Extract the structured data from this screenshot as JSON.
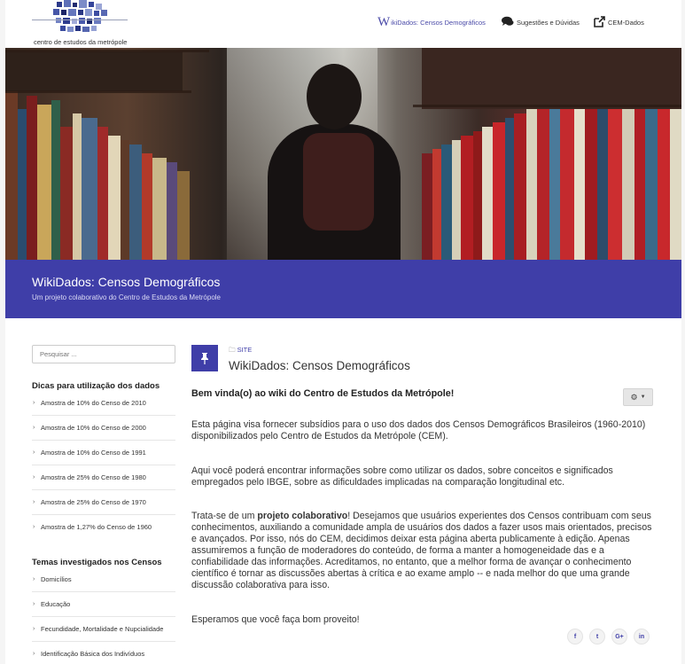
{
  "header": {
    "logo_text": "centro de estudos da metrópole",
    "nav": [
      {
        "prefix": "W",
        "label": "ikiDados: Censos Demográficos"
      },
      {
        "label": "Sugestões e Dúvidas",
        "icon": "comments-icon"
      },
      {
        "label": "CEM-Dados",
        "icon": "external-link-icon"
      }
    ]
  },
  "banner": {
    "title": "WikiDados: Censos Demográficos",
    "subtitle": "Um projeto colaborativo do Centro de Estudos da Metrópole"
  },
  "sidebar": {
    "search_placeholder": "Pesquisar ...",
    "section1_title": "Dicas para utilização dos dados",
    "section1_items": [
      "Amostra de 10% do Censo de 2010",
      "Amostra de 10% do Censo de 2000",
      "Amostra de 10% do Censo de 1991",
      "Amostra de 25% do Censo de 1980",
      "Amostra de 25% do Censo de 1970",
      "Amostra de 1,27% do Censo de 1960"
    ],
    "section2_title": "Temas investigados nos Censos",
    "section2_items": [
      "Domicílios",
      "Educação",
      "Fecundidade, Mortalidade e Nupcialidade",
      "Identificação Básica dos Indivíduos"
    ]
  },
  "main": {
    "breadcrumb": "SITE",
    "title": "WikiDados: Censos Demográficos",
    "welcome_pre": "Bem vinda(o) ao wiki do ",
    "welcome_bold": "Centro de Estudos da Metrópole!",
    "p1": "Esta página visa fornecer subsídios para o uso dos dados dos Censos Demográficos Brasileiros (1960-2010) disponibilizados pelo Centro de Estudos da Metrópole (CEM).",
    "p2": "Aqui você poderá encontrar informações sobre como utilizar os dados, sobre conceitos e significados empregados pelo IBGE, sobre as dificuldades implicadas na comparação longitudinal etc.",
    "p3_pre": "Trata-se de um ",
    "p3_bold": "projeto colaborativo",
    "p3_post": "! Desejamos que usuários experientes dos Censos contribuam com seus conhecimentos, auxiliando a comunidade ampla de usuários dos dados a fazer usos mais orientados, precisos e avançados. Por isso, nós do CEM, decidimos deixar esta página aberta publicamente à edição. Apenas assumiremos a função de moderadores do conteúdo, de forma a manter a homogeneidade das e a confiabilidade das informações. Acreditamos, no entanto, que a melhor forma de avançar o conhecimento científico é tornar as discussões abertas à crítica e ao exame amplo -- e nada melhor do que uma grande discussão colaborativa para isso.",
    "p4": "Esperamos que você faça bom proveito!",
    "share": [
      "f",
      "t",
      "G+",
      "in"
    ]
  },
  "colors": {
    "brand": "#3f3ea8"
  }
}
